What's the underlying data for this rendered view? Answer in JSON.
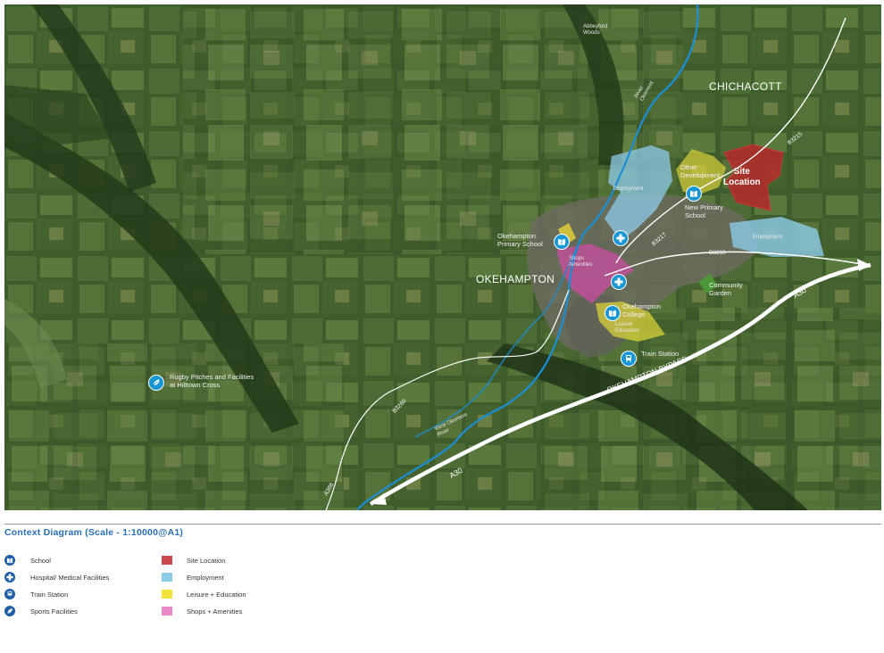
{
  "labels": {
    "chichacott": "CHICHACOTT",
    "okehampton": "OKEHAMPTON",
    "site_location": "Site\nLocation",
    "employment_north": "Employment",
    "employment_east": "Employment",
    "other_development": "Other\nDevelopment",
    "new_primary_school": "New Primary\nSchool",
    "okehampton_primary": "Okehampton\nPrimary School",
    "shops_amenities": "Shops\nAmenities",
    "community_garden": "Community\nGarden",
    "okehampton_college": "Okehampton\nCollege",
    "leisure_education": "Leisure\nEducation",
    "train_station": "Train Station",
    "rugby": "Rugby Pitches and Facilities\nat Hilltown Cross",
    "river_okement": "River\nOkement",
    "west_okement": "West Okement\nRiver",
    "abbeyford": "Abbeyford\nWoods",
    "bypass": "OKEHAMPTON BYPASS",
    "road_a30_east": "A30",
    "road_a30_west": "A30",
    "road_b3215": "B3215",
    "road_b3260_east": "B3260",
    "road_b3260_west": "B3260",
    "road_a386": "A386",
    "road_b3217": "B3217"
  },
  "caption": "Context Diagram (Scale - 1:10000@A1)",
  "legend": {
    "icons": [
      {
        "label": "School",
        "icon": "book-icon"
      },
      {
        "label": "Hospital/ Medical Facilities",
        "icon": "cross-icon"
      },
      {
        "label": "Train Station",
        "icon": "train-icon"
      },
      {
        "label": "Sports Facilities",
        "icon": "leaf-icon"
      }
    ],
    "swatches": [
      {
        "label": "Site Location",
        "color": "#c9494c"
      },
      {
        "label": "Employment",
        "color": "#8ccbe8"
      },
      {
        "label": "Leisure + Education",
        "color": "#efe23a"
      },
      {
        "label": "Shops + Amenities",
        "color": "#eb8ac8"
      }
    ]
  },
  "colors": {
    "pin": "#1996d4",
    "legend_icon": "#1e5fa8",
    "caption": "#2a6fb5",
    "river": "#1a8fd6"
  }
}
